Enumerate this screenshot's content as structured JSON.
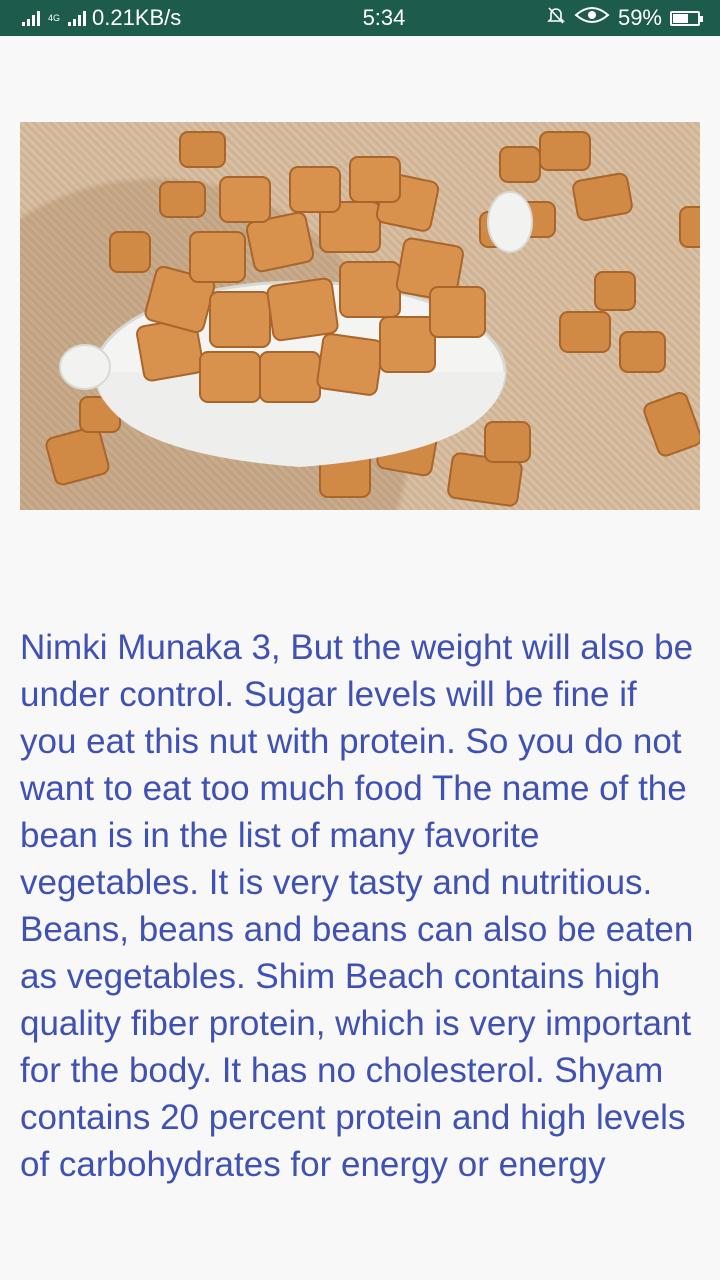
{
  "status_bar": {
    "network_type": "4G",
    "data_speed": "0.21KB/s",
    "time": "5:34",
    "battery_percent": "59%",
    "battery_level": 0.59,
    "icons": [
      "signal-icon",
      "mute-icon",
      "eye-icon",
      "battery-icon"
    ]
  },
  "article": {
    "image_alt": "Bowl of fried nimki snack pieces",
    "body": "Nimki Munaka 3, But the weight will also be under control. Sugar levels will be fine if you eat this nut with protein. So you do not want to eat too much food The name of the bean is in the list of many favorite vegetables. It is very tasty and nutritious. Beans, beans and beans can also be eaten as vegetables. Shim Beach contains high quality fiber protein, which is very important for the body. It has no cholesterol. Shyam contains 20 percent protein and high levels of carbohydrates for energy or energy"
  },
  "colors": {
    "status_bar_bg": "#1d5b4d",
    "text": "#3f51b5",
    "background": "#f8f8f8"
  }
}
